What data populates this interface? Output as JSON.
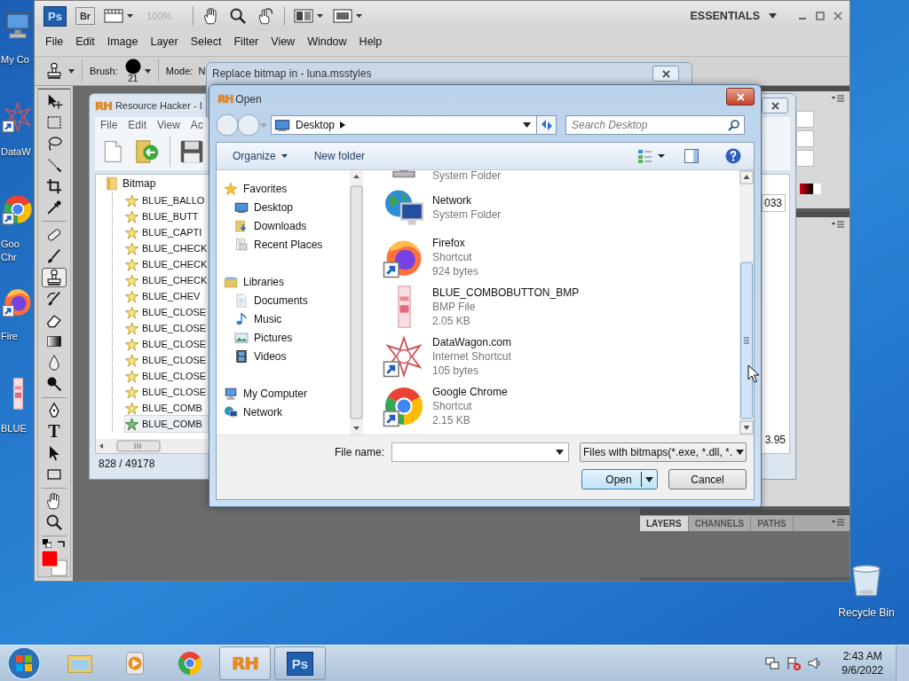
{
  "desktop": {
    "icons": [
      {
        "label": "My Co",
        "kind": "computer",
        "shortcut": false
      },
      {
        "label": "DataW",
        "kind": "web",
        "shortcut": true
      },
      {
        "label": "Goo Chr",
        "kind": "chrome",
        "shortcut": true
      },
      {
        "label": "Fire",
        "kind": "firefox",
        "shortcut": true
      },
      {
        "label": "BLUE",
        "kind": "bitmap",
        "shortcut": false
      }
    ],
    "recycle_bin": {
      "label": "Recycle Bin"
    }
  },
  "photoshop": {
    "app_bar": {
      "logo": "Ps",
      "bridge": "Br",
      "zoom": "100%",
      "workspace": "ESSENTIALS"
    },
    "menu": [
      "File",
      "Edit",
      "Image",
      "Layer",
      "Select",
      "Filter",
      "View",
      "Window",
      "Help"
    ],
    "options_bar": {
      "brush_label": "Brush:",
      "brush_size": "21",
      "mode_label": "Mode:",
      "mode_value": "N"
    },
    "toolbox": {
      "type_glyph": "T"
    },
    "panel_tabs": [
      {
        "label": "LAYERS",
        "selected": true
      },
      {
        "label": "CHANNELS",
        "selected": false
      },
      {
        "label": "PATHS",
        "selected": false
      }
    ]
  },
  "resource_hacker": {
    "logo": "RH",
    "title": "Resource Hacker - I",
    "menu": [
      "File",
      "Edit",
      "View",
      "Ac"
    ],
    "tree": {
      "label": "Bitmap",
      "expanded": true,
      "children": [
        {
          "label": "BLUE_BALLO",
          "selected": false
        },
        {
          "label": "BLUE_BUTT",
          "selected": false
        },
        {
          "label": "BLUE_CAPTI",
          "selected": false
        },
        {
          "label": "BLUE_CHECK",
          "selected": false
        },
        {
          "label": "BLUE_CHECK",
          "selected": false
        },
        {
          "label": "BLUE_CHECK",
          "selected": false
        },
        {
          "label": "BLUE_CHEV",
          "selected": false
        },
        {
          "label": "BLUE_CLOSE",
          "selected": false
        },
        {
          "label": "BLUE_CLOSE",
          "selected": false
        },
        {
          "label": "BLUE_CLOSE",
          "selected": false
        },
        {
          "label": "BLUE_CLOSE",
          "selected": false
        },
        {
          "label": "BLUE_CLOSE",
          "selected": false
        },
        {
          "label": "BLUE_CLOSE",
          "selected": false
        },
        {
          "label": "BLUE_COMB",
          "selected": false
        },
        {
          "label": "BLUE_COMB",
          "selected": true
        }
      ]
    },
    "field_value": "033",
    "reading": "3.95",
    "status": "828 / 49178"
  },
  "replace_dialog": {
    "title": "Replace bitmap in - luna.msstyles"
  },
  "open_dialog": {
    "logo": "RH",
    "title": "Open",
    "address": "Desktop",
    "search": {
      "placeholder": "Search Desktop"
    },
    "toolbar": {
      "organize": "Organize",
      "new_folder": "New folder"
    },
    "nav": [
      {
        "label": "Favorites",
        "kind": "star",
        "children": [
          {
            "label": "Desktop",
            "kind": "desktop"
          },
          {
            "label": "Downloads",
            "kind": "downloads"
          },
          {
            "label": "Recent Places",
            "kind": "recent"
          }
        ]
      },
      {
        "label": "Libraries",
        "kind": "libraries",
        "children": [
          {
            "label": "Documents",
            "kind": "documents"
          },
          {
            "label": "Music",
            "kind": "music"
          },
          {
            "label": "Pictures",
            "kind": "pictures"
          },
          {
            "label": "Videos",
            "kind": "videos"
          }
        ]
      },
      {
        "label": "My Computer",
        "kind": "computer"
      },
      {
        "label": "Network",
        "kind": "network"
      }
    ],
    "files": [
      {
        "type": "System Folder",
        "kind": "computer",
        "shortcut": false
      },
      {
        "name": "Network",
        "type": "System Folder",
        "kind": "network",
        "shortcut": false
      },
      {
        "name": "Firefox",
        "type": "Shortcut",
        "size": "924 bytes",
        "kind": "firefox",
        "shortcut": true
      },
      {
        "name": "BLUE_COMBOBUTTON_BMP",
        "type": "BMP File",
        "size": "2.05 KB",
        "kind": "bitmap",
        "shortcut": false
      },
      {
        "name": "DataWagon.com",
        "type": "Internet Shortcut",
        "size": "105 bytes",
        "kind": "web",
        "shortcut": true
      },
      {
        "name": "Google Chrome",
        "type": "Shortcut",
        "size": "2.15 KB",
        "kind": "chrome",
        "shortcut": true
      }
    ],
    "file_name": {
      "label": "File name:"
    },
    "filter": "Files with bitmaps(*.exe, *.dll, *.",
    "buttons": {
      "open": "Open",
      "cancel": "Cancel"
    }
  },
  "taskbar": {
    "items": [
      {
        "kind": "explorer",
        "open": false
      },
      {
        "kind": "media",
        "open": false
      },
      {
        "kind": "chrome",
        "open": false
      },
      {
        "kind": "rh",
        "label": "RH",
        "open": true
      },
      {
        "kind": "ps",
        "label": "Ps",
        "open": true
      }
    ],
    "clock": {
      "time": "2:43 AM",
      "date": "9/6/2022"
    }
  }
}
